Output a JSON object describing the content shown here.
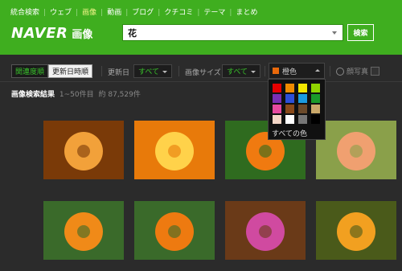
{
  "nav": {
    "items": [
      {
        "label": "統合検索",
        "active": false
      },
      {
        "label": "ウェブ",
        "active": false
      },
      {
        "label": "画像",
        "active": true
      },
      {
        "label": "動画",
        "active": false
      },
      {
        "label": "ブログ",
        "active": false
      },
      {
        "label": "クチコミ",
        "active": false
      },
      {
        "label": "テーマ",
        "active": false
      },
      {
        "label": "まとめ",
        "active": false
      }
    ]
  },
  "logo": {
    "text": "NAVER",
    "sub": "画像"
  },
  "search": {
    "value": "花",
    "button_label": "検索"
  },
  "sort": {
    "relevance_label": "関連度順",
    "recent_label": "更新日時順"
  },
  "filters": {
    "date_label": "更新日",
    "date_value": "すべて",
    "size_label": "画像サイズ",
    "size_value": "すべて",
    "color_value": "橙色",
    "face_label": "顔写真"
  },
  "results": {
    "title": "画像検索結果",
    "range": "1~50件目",
    "count": "約 87,529件"
  },
  "palette": {
    "colors": [
      "#e60000",
      "#f08a00",
      "#f2e600",
      "#8fd400",
      "#7a2fb3",
      "#2d4fd8",
      "#1b9be0",
      "#1a9a2a",
      "#e64aa0",
      "#8a4a1a",
      "#6b4a2a",
      "#c9a86a",
      "#f3d6c6",
      "#ffffff",
      "#777777",
      "#000000"
    ],
    "all_label": "すべての色"
  },
  "images": [
    {
      "name": "image-result-building",
      "colors": [
        "#7a3a08",
        "#f2a13a"
      ]
    },
    {
      "name": "image-result-orange-tulip",
      "colors": [
        "#e87a0a",
        "#ffd24a"
      ]
    },
    {
      "name": "image-result-marigold-green",
      "colors": [
        "#2f6b1f",
        "#f07a10"
      ]
    },
    {
      "name": "image-result-pink-flower",
      "colors": [
        "#8aa04a",
        "#f0a070"
      ]
    },
    {
      "name": "image-result-cosmos",
      "colors": [
        "#3a6a2a",
        "#f08a18"
      ]
    },
    {
      "name": "image-result-marigold-pair",
      "colors": [
        "#3a6a2a",
        "#ee7a10"
      ]
    },
    {
      "name": "image-result-flower-arrangement",
      "colors": [
        "#6a3a18",
        "#d04aa0"
      ]
    },
    {
      "name": "image-result-flower-field",
      "colors": [
        "#4a5a1a",
        "#f2a020"
      ]
    }
  ]
}
